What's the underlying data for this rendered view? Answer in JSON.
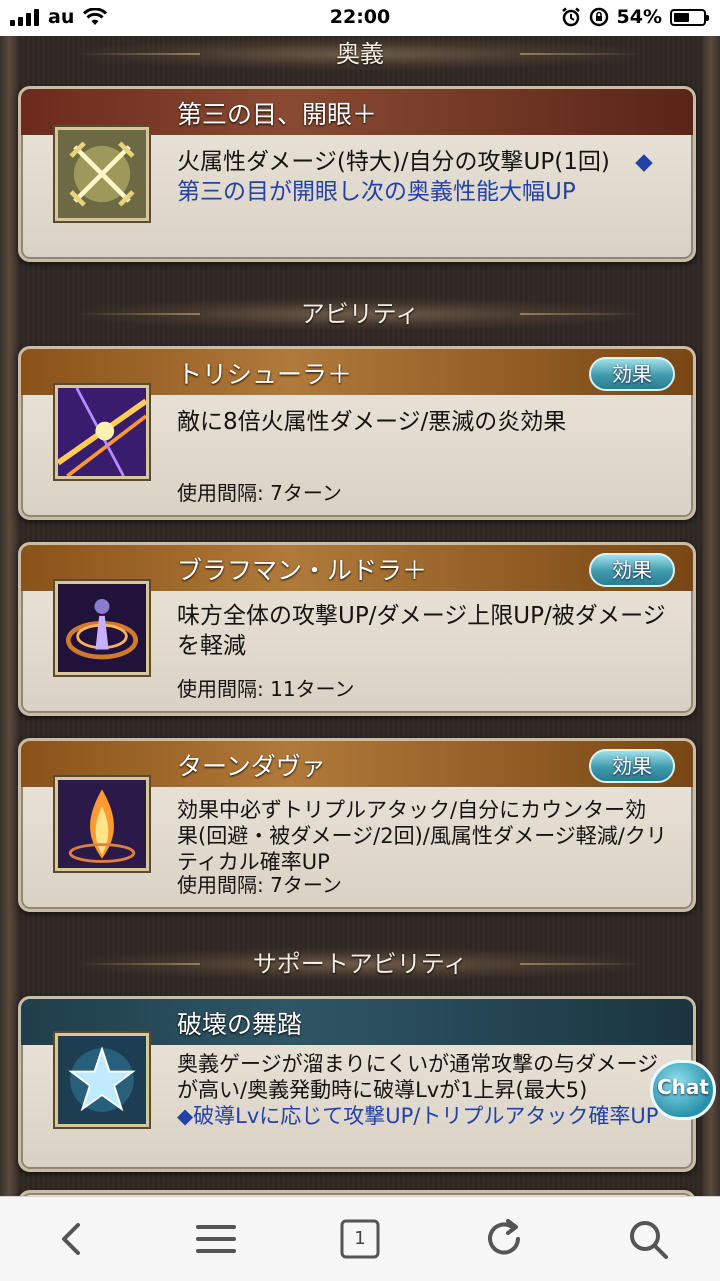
{
  "status_bar": {
    "carrier": "au",
    "time": "22:00",
    "battery": "54%",
    "battery_level": 0.54
  },
  "sections": {
    "ougi": "奥義",
    "ability": "アビリティ",
    "support": "サポートアビリティ"
  },
  "ougi_card": {
    "title": "第三の目、開眼＋",
    "desc": "火属性ダメージ(特大)/自分の攻撃UP(1回)",
    "desc_note": "◆第三の目が開眼し次の奥義性能大幅UP",
    "icon": "crossed-swords-icon"
  },
  "abilities": [
    {
      "name": "トリシューラ＋",
      "desc": "敵に8倍火属性ダメージ/悪滅の炎効果",
      "interval": "使用間隔: 7ターン",
      "button": "効果",
      "icon": "trishula-icon"
    },
    {
      "name": "ブラフマン・ルドラ＋",
      "desc": "味方全体の攻撃UP/ダメージ上限UP/被ダメージを軽減",
      "interval": "使用間隔: 11ターン",
      "button": "効果",
      "icon": "brahman-rudra-icon"
    },
    {
      "name": "ターンダヴァ",
      "desc": "効果中必ずトリプルアタック/自分にカウンター効果(回避・被ダメージ/2回)/風属性ダメージ軽減/クリティカル確率UP",
      "interval": "使用間隔: 7ターン",
      "button": "効果",
      "icon": "tandava-icon"
    }
  ],
  "support_card": {
    "title": "破壊の舞踏",
    "desc": "奥義ゲージが溜まりにくいが通常攻撃の与ダメージが高い/奥義発動時に破導Lvが1上昇(最大5)",
    "desc_note": "◆破導Lvに応じて攻撃UP/トリプルアタック確率UP",
    "icon": "star-icon"
  },
  "chat_label": "Chat",
  "toolbar": {
    "tab_count": "1",
    "icons": [
      "back-icon",
      "menu-icon",
      "tabs-icon",
      "reload-icon",
      "search-icon"
    ]
  }
}
